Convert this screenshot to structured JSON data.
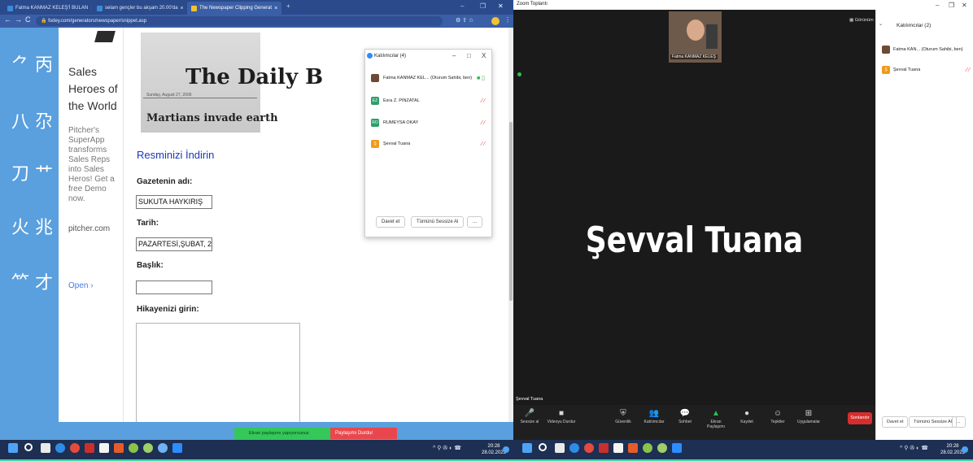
{
  "browser": {
    "tabs": [
      {
        "label": "Fatma KANMAZ KELEŞ'İ BULAN"
      },
      {
        "label": "selam gençler bu akşam 20.00'da"
      },
      {
        "label": "The Newspaper Clipping Generat"
      }
    ],
    "new_tab_glyph": "+",
    "address": "fodey.com/generators/newspaper/snippet.asp",
    "nav": {
      "back": "←",
      "forward": "→",
      "reload": "C"
    }
  },
  "ad": {
    "headline": "Sales Heroes of the World",
    "body": "Pitcher's SuperApp transforms Sales Reps into Sales Heros! Get a free Demo now.",
    "domain": "pitcher.com",
    "open_label": "Open",
    "open_arrow": "›"
  },
  "newspaper": {
    "title": "The Daily B",
    "date_line": "Sunday, August 27, 2006",
    "headline": "Martians invade earth"
  },
  "form": {
    "heading": "Resminizi İndirin",
    "newspaper_name_label": "Gazetenin adı:",
    "newspaper_name_value": "SUKUTA HAYKIRIŞ",
    "date_label": "Tarih:",
    "date_value": "PAZARTESİ,ŞUBAT, 28, 20",
    "headline_label": "Başlık:",
    "headline_value": "",
    "story_label": "Hikayenizi girin:"
  },
  "participants_popup": {
    "title": "Katılımcılar (4)",
    "minimize": "–",
    "maximize": "□",
    "close": "X",
    "rows": [
      {
        "initials": "",
        "name": "Fatma KANMAZ KEL... (Oturum Sahibi, ben)",
        "color": "#6b4b35"
      },
      {
        "initials": "EZ",
        "name": "Esra Z. PINZATAL",
        "color": "#2e9e6a"
      },
      {
        "initials": "RO",
        "name": "RÜMEYSA OKAY",
        "color": "#2e9e6a"
      },
      {
        "initials": "Ş",
        "name": "Şevval Tuana",
        "color": "#f09a1a"
      }
    ],
    "invite_label": "Davet et",
    "mute_all_label": "Tümünü Sessize Al",
    "more_label": "..."
  },
  "share_bar": {
    "sharing_text": "Ekran paylaşımı yapıyorsunuz",
    "stop_label": "Paylaşımı Durdur"
  },
  "taskbar_left": {
    "time": "20:28",
    "date": "28.02.2022"
  },
  "taskbar_right": {
    "time": "20:28",
    "date": "28.02.2022"
  },
  "zoom": {
    "window_title": "Zoom Toplantı",
    "active_speaker": "Şevval Tuana",
    "thumb_label": "Fatma KANMAZ KELEŞ",
    "view_label": "Görünüm",
    "speaker_tag": "Şevval Tuana",
    "toolbar": [
      {
        "icon": "🎤",
        "label": "Sessize al"
      },
      {
        "icon": "■",
        "label": "Videoyu Durdur"
      },
      {
        "icon": "⛨",
        "label": "Güvenlik"
      },
      {
        "icon": "👥",
        "label": "Katılımcılar"
      },
      {
        "icon": "💬",
        "label": "Sohbet"
      },
      {
        "icon": "▲",
        "label": "Ekran Paylaşımı"
      },
      {
        "icon": "●",
        "label": "Kaydet"
      },
      {
        "icon": "☺",
        "label": "Tepkiler"
      },
      {
        "icon": "⊞",
        "label": "Uygulamalar"
      }
    ],
    "end_label": "Sonlandır",
    "panel_title": "Katılımcılar (2)",
    "panel_rows": [
      {
        "name": "Fatma KAN... (Oturum Sahibi, ben)",
        "color": "#6b4b35",
        "initial": ""
      },
      {
        "name": "Şevval Tuana",
        "color": "#f09a1a",
        "initial": "Ş"
      }
    ],
    "panel_invite": "Davet et",
    "panel_mute_all": "Tümünü Sessize Al",
    "panel_more": "..."
  },
  "colors": {
    "chrome_blue": "#3b5fa6",
    "side_blue": "#5a9fde",
    "share_green": "#34c759",
    "stop_red": "#e8484d"
  }
}
